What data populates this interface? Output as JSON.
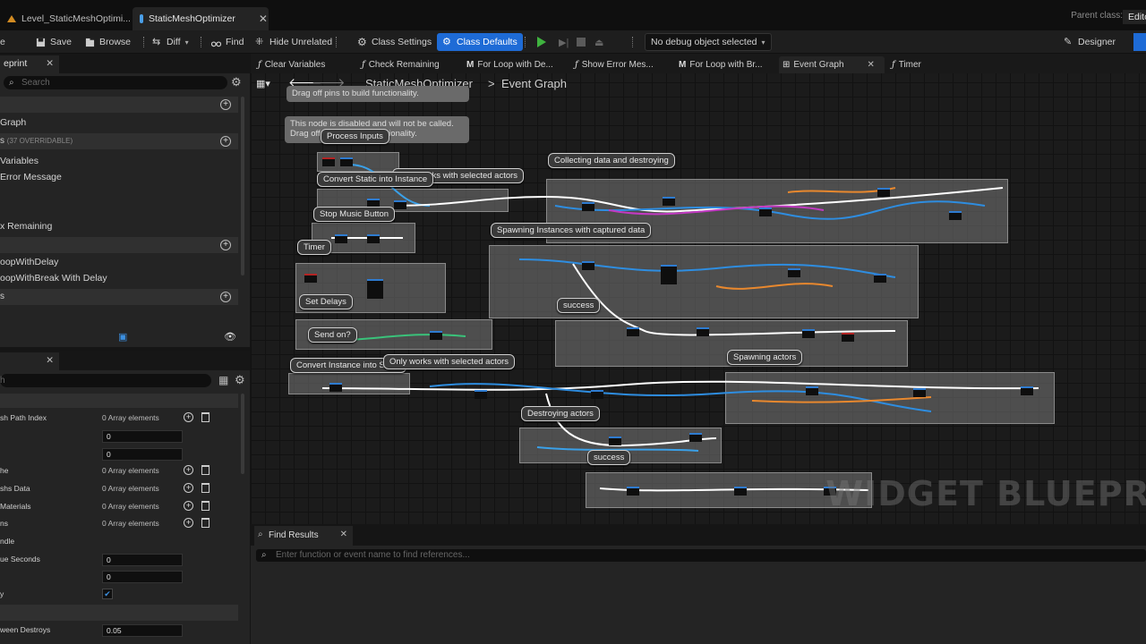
{
  "window_tabs": [
    {
      "label": "Level_StaticMeshOptimi...",
      "icon": "unreal-level-icon"
    },
    {
      "label": "StaticMeshOptimizer",
      "icon": "blueprint-icon"
    }
  ],
  "parent_class": {
    "label": "Parent class:",
    "value": "Editor"
  },
  "toolbar": {
    "save": "Save",
    "browse": "Browse",
    "diff": "Diff",
    "find": "Find",
    "hide_unrelated": "Hide Unrelated",
    "class_settings": "Class Settings",
    "class_defaults": "Class Defaults",
    "debug_object": "No debug object selected",
    "designer": "Designer"
  },
  "my_blueprint": {
    "tab_label": "eprint",
    "search_placeholder": "Search",
    "items": [
      "Graph",
      "Variables",
      "Error Message",
      "x Remaining",
      "oopWithDelay",
      "oopWithBreak With Delay"
    ],
    "functions_header": "s",
    "functions_overridable": "(37 OVERRIDABLE)",
    "macros_header": "s"
  },
  "details": {
    "search_placeholder": "h",
    "rows": [
      {
        "label": "sh Path Index",
        "value": "0 Array elements"
      },
      {
        "label": "",
        "value": "0"
      },
      {
        "label": "",
        "value": "0"
      },
      {
        "label": "he",
        "value": "0 Array elements"
      },
      {
        "label": "shs Data",
        "value": "0 Array elements"
      },
      {
        "label": "Materials",
        "value": "0 Array elements"
      },
      {
        "label": "ns",
        "value": "0 Array elements"
      },
      {
        "label": "ndle",
        "value": ""
      },
      {
        "label": "ue  Seconds",
        "value": "0"
      },
      {
        "label": "",
        "value": "0"
      },
      {
        "label": "y",
        "value": "✔"
      },
      {
        "label": "ween Destroys",
        "value": "0.05"
      }
    ]
  },
  "graph_tabs": [
    {
      "kind": "f",
      "label": "Clear Variables"
    },
    {
      "kind": "f",
      "label": "Check Remaining"
    },
    {
      "kind": "M",
      "label": "For Loop with De..."
    },
    {
      "kind": "f",
      "label": "Show Error Mes..."
    },
    {
      "kind": "M",
      "label": "For Loop with Br..."
    },
    {
      "kind": "grid",
      "label": "Event Graph"
    },
    {
      "kind": "f",
      "label": "Timer"
    }
  ],
  "breadcrumb": {
    "root": "StaticMeshOptimizer",
    "sep": ">",
    "current": "Event Graph"
  },
  "disabled_notes": [
    "Drag off pins to build functionality.",
    "This node is disabled and will not be called.\nDrag off pins to build functionality."
  ],
  "comments": [
    "Process Inputs",
    "Only works with selected actors",
    "Collecting data and destroying",
    "Convert Static into Instance",
    "Stop Music Button",
    "Spawning Instances with captured data",
    "Timer",
    "success",
    "Set Delays",
    "Send on?",
    "Convert Instance into Static",
    "Only works with selected actors",
    "Spawning actors",
    "Destroying actors",
    "success"
  ],
  "watermark": "WIDGET BLUEPRI",
  "find_results": {
    "tab": "Find Results",
    "placeholder": "Enter function or event name to find references..."
  }
}
